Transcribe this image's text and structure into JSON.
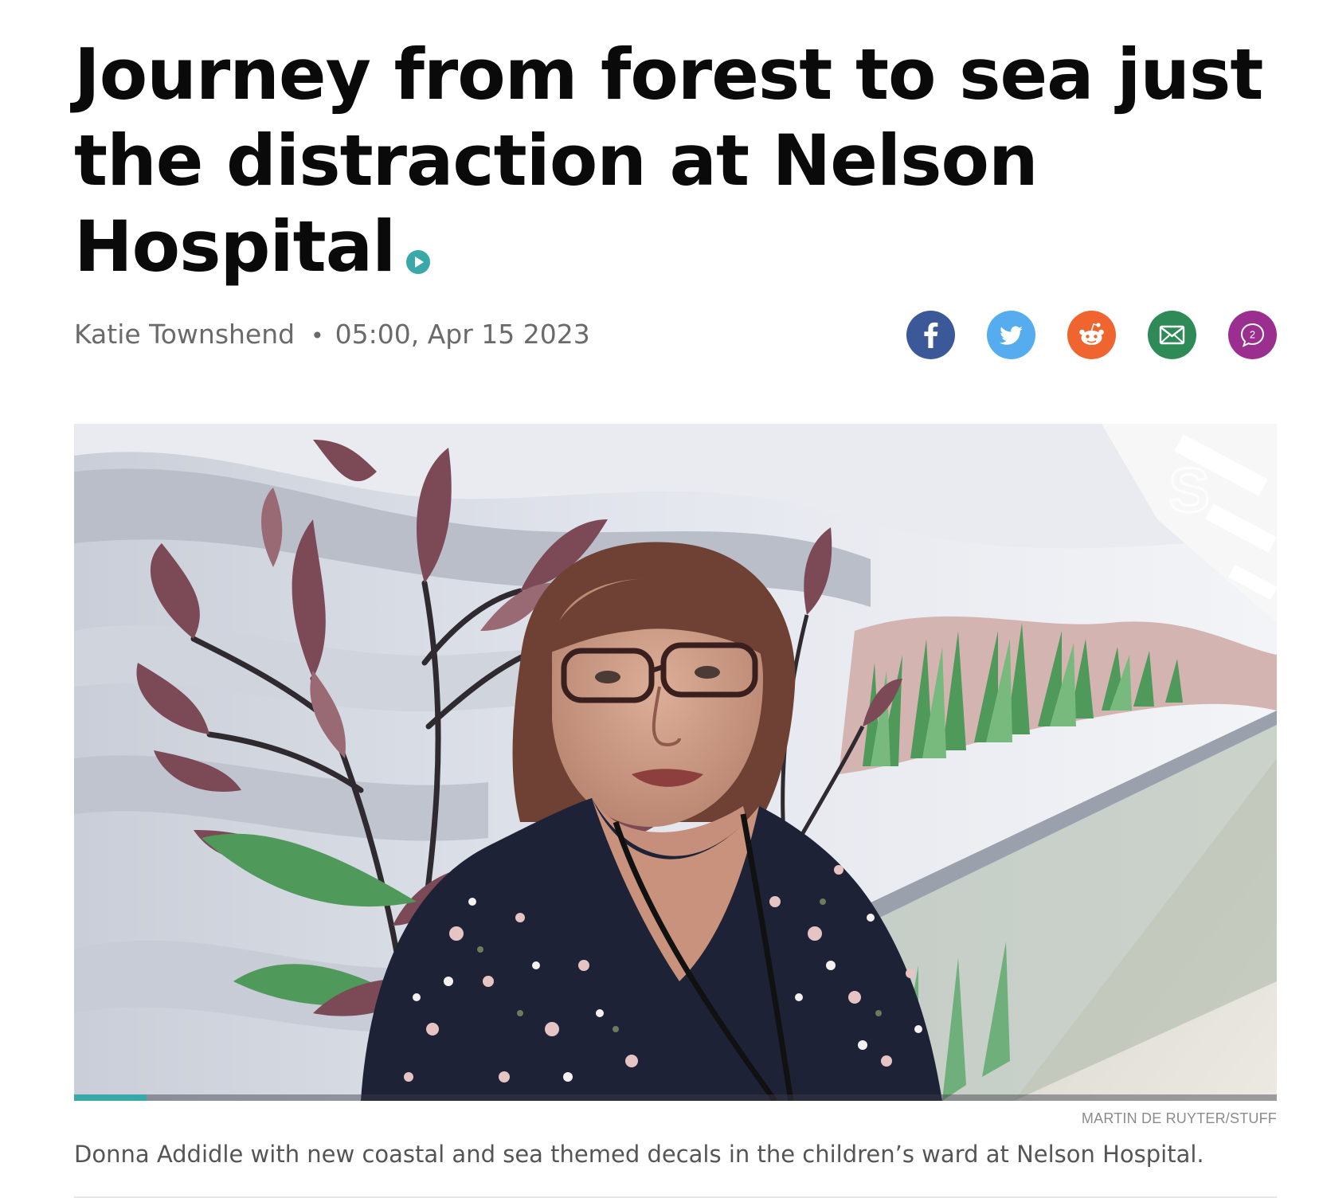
{
  "article": {
    "headline": "Journey from forest to sea just the distraction at Nelson Hospital",
    "author": "Katie Townshend",
    "separator": "•",
    "timestamp": "05:00, Apr 15 2023",
    "has_video_badge": true
  },
  "share": {
    "buttons": [
      {
        "name": "facebook",
        "icon": "facebook-icon",
        "color": "#3b5998"
      },
      {
        "name": "twitter",
        "icon": "twitter-bird-icon",
        "color": "#55acee"
      },
      {
        "name": "reddit",
        "icon": "reddit-icon",
        "color": "#f0652f"
      },
      {
        "name": "email",
        "icon": "envelope-icon",
        "color": "#2e8b57"
      },
      {
        "name": "comments",
        "icon": "comment-icon",
        "color": "#9b2f8f"
      }
    ],
    "comment_count": "2"
  },
  "media": {
    "watermark": "S",
    "progress_fraction": 0.06,
    "progress_color": "#3aa7a8"
  },
  "photo_credit": "MARTIN DE RUYTER/STUFF",
  "caption": "Donna Addidle with new coastal and sea themed decals in the children’s ward at Nelson Hospital."
}
